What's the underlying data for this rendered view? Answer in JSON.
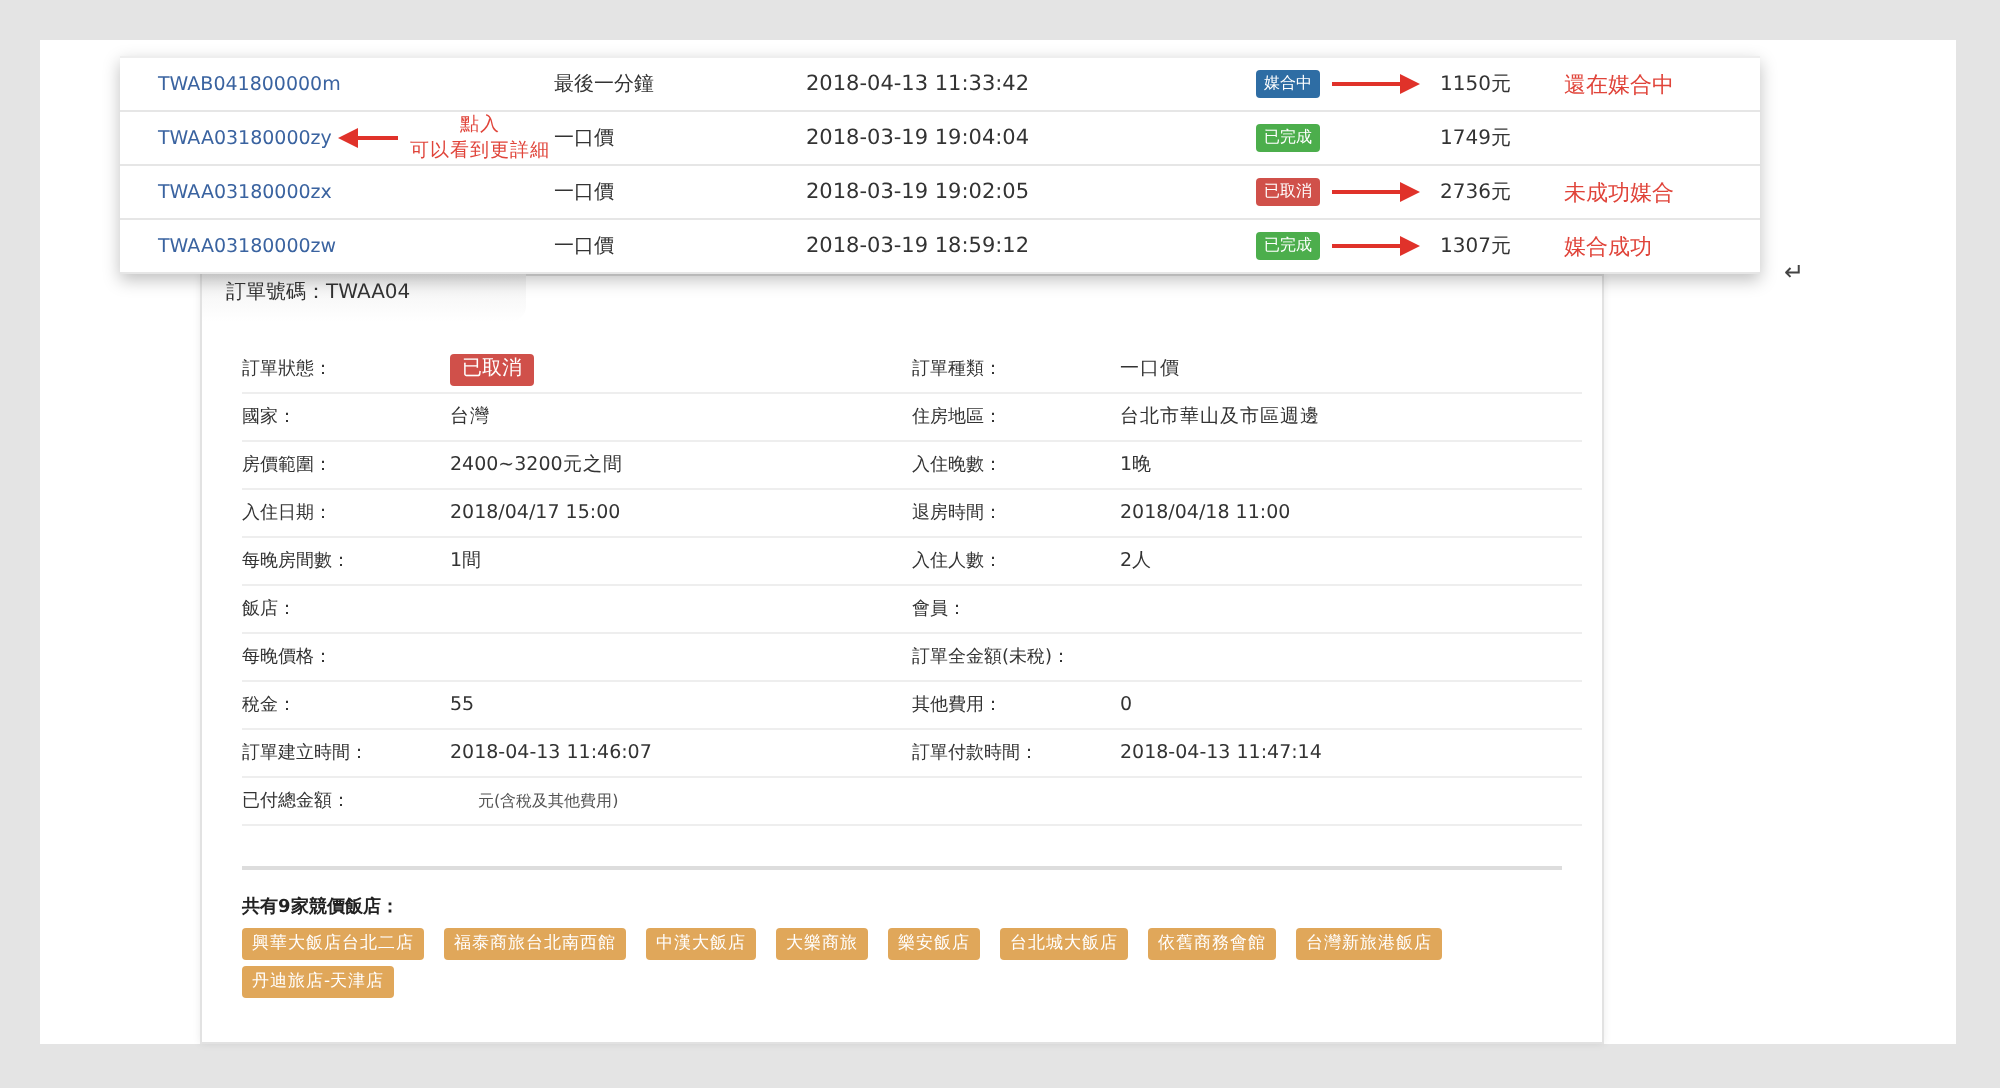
{
  "orders": [
    {
      "id": "TWAB041800000m",
      "type": "最後一分鐘",
      "time": "2018-04-13 11:33:42",
      "status": {
        "label": "媒合中",
        "kind": "matching"
      },
      "price": "1150元",
      "note": {
        "lines": [
          "還在媒合中"
        ],
        "kind": "right"
      }
    },
    {
      "id": "TWAA03180000zy",
      "type": "一口價",
      "time": "2018-03-19 19:04:04",
      "status": {
        "label": "已完成",
        "kind": "done"
      },
      "price": "1749元",
      "note": {
        "lines": [
          "點入",
          "可以看到更詳細"
        ],
        "kind": "left"
      }
    },
    {
      "id": "TWAA03180000zx",
      "type": "一口價",
      "time": "2018-03-19 19:02:05",
      "status": {
        "label": "已取消",
        "kind": "cancelled"
      },
      "price": "2736元",
      "note": {
        "lines": [
          "未成功媒合"
        ],
        "kind": "right"
      }
    },
    {
      "id": "TWAA03180000zw",
      "type": "一口價",
      "time": "2018-03-19 18:59:12",
      "status": {
        "label": "已完成",
        "kind": "done"
      },
      "price": "1307元",
      "note": {
        "lines": [
          "媒合成功"
        ],
        "kind": "right"
      }
    }
  ],
  "paragraph_mark": "↵",
  "detail": {
    "title": "訂單號碼：TWAA04",
    "rows": [
      [
        {
          "label": "訂單狀態：",
          "status": {
            "label": "已取消",
            "kind": "cancelled"
          }
        },
        {
          "label": "訂單種類：",
          "value": "一口價"
        }
      ],
      [
        {
          "label": "國家：",
          "value": "台灣"
        },
        {
          "label": "住房地區：",
          "value": "台北市華山及市區週邊"
        }
      ],
      [
        {
          "label": "房價範圍：",
          "value": "2400~3200元之間"
        },
        {
          "label": "入住晚數：",
          "value": "1晚"
        }
      ],
      [
        {
          "label": "入住日期：",
          "value": "2018/04/17 15:00"
        },
        {
          "label": "退房時間：",
          "value": "2018/04/18 11:00"
        }
      ],
      [
        {
          "label": "每晚房間數：",
          "value": "1間"
        },
        {
          "label": "入住人數：",
          "value": "2人"
        }
      ],
      [
        {
          "label": "飯店："
        },
        {
          "label": "會員："
        }
      ],
      [
        {
          "label": "每晚價格："
        },
        {
          "label": "訂單全金額(未稅)："
        }
      ],
      [
        {
          "label": "稅金：",
          "value": "55"
        },
        {
          "label": "其他費用：",
          "value": "0"
        }
      ],
      [
        {
          "label": "訂單建立時間：",
          "value": "2018-04-13 11:46:07"
        },
        {
          "label": "訂單付款時間：",
          "value": "2018-04-13 11:47:14"
        }
      ],
      [
        {
          "label": "已付總金額：",
          "value": "元(含稅及其他費用)"
        }
      ]
    ],
    "hotels_title": "共有9家競價飯店：",
    "hotels": [
      "興華大飯店台北二店",
      "福泰商旅台北南西館",
      "中漢大飯店",
      "大樂商旅",
      "樂安飯店",
      "台北城大飯店",
      "依舊商務會館",
      "台灣新旅港飯店",
      "丹迪旅店-天津店"
    ]
  }
}
